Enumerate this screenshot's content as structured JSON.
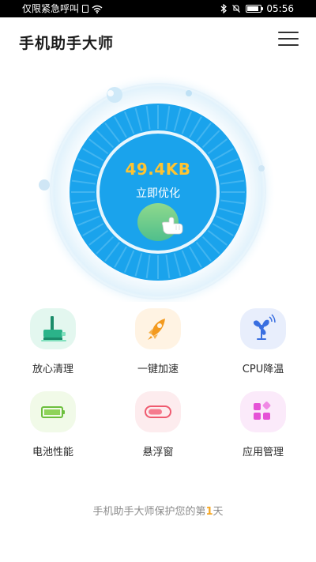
{
  "status_bar": {
    "carrier_text": "仅限紧急呼叫",
    "sim_icon": "sim-icon",
    "time": "05:56",
    "battery_level": 0.9
  },
  "header": {
    "title": "手机助手大师",
    "menu_icon": "hamburger-menu-icon"
  },
  "hero": {
    "size_value": "49.4KB",
    "action_label": "立即优化",
    "colors": {
      "ring": "#1aa3ec",
      "center": "#1aa3ec",
      "value": "#ffc430",
      "wave": "#7fd184"
    }
  },
  "features": [
    {
      "label": "放心清理",
      "icon": "broom-clean-icon",
      "tile_color": "#e3f7ef"
    },
    {
      "label": "一键加速",
      "icon": "rocket-icon",
      "tile_color": "#fff3e3"
    },
    {
      "label": "CPU降温",
      "icon": "fan-icon",
      "tile_color": "#e8eefc"
    },
    {
      "label": "电池性能",
      "icon": "battery-icon",
      "tile_color": "#f1fae8"
    },
    {
      "label": "悬浮窗",
      "icon": "toggle-icon",
      "tile_color": "#fdecee"
    },
    {
      "label": "应用管理",
      "icon": "apps-grid-icon",
      "tile_color": "#fbeafa"
    }
  ],
  "footer": {
    "prefix": "手机助手大师保护您的第",
    "day": "1",
    "suffix": "天"
  }
}
